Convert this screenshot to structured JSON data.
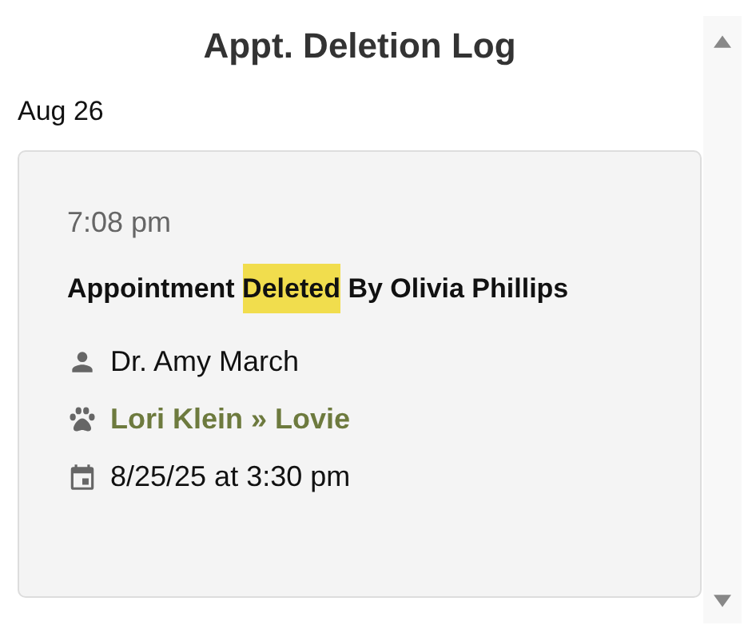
{
  "header": {
    "title": "Appt. Deletion Log"
  },
  "date_group": "Aug 26",
  "entries": [
    {
      "time": "7:08 pm",
      "title_parts": [
        {
          "text": "Appointment ",
          "highlighted": false
        },
        {
          "text": "Deleted",
          "highlighted": true
        },
        {
          "text": " By Olivia Phillips",
          "highlighted": false
        }
      ],
      "details": [
        {
          "kind": "person",
          "text": "Dr. Amy March"
        },
        {
          "kind": "pet",
          "text": "Lori Klein » Lovie"
        },
        {
          "kind": "date",
          "text": "8/25/25 at 3:30 pm"
        }
      ]
    }
  ]
}
